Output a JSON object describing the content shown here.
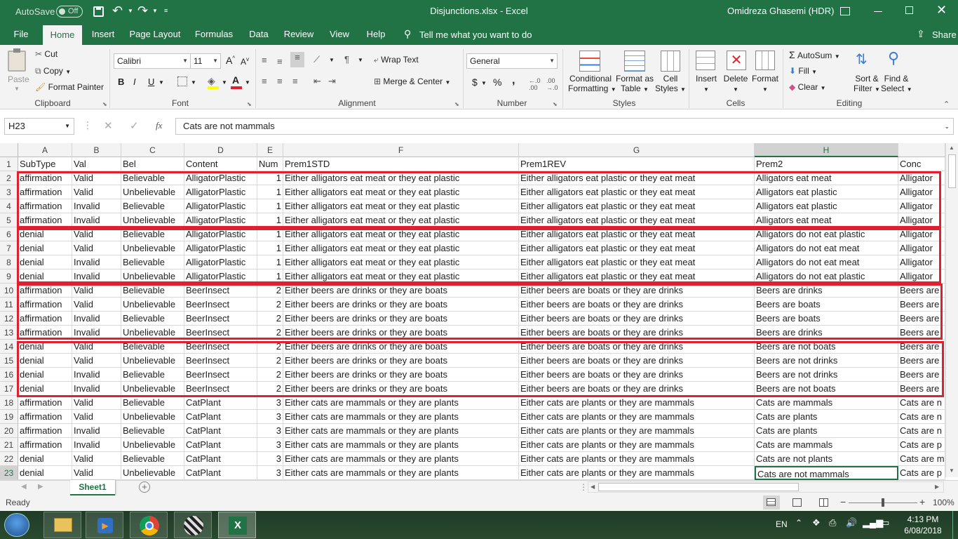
{
  "titlebar": {
    "autosave_label": "AutoSave",
    "autosave_state": "Off",
    "title": "Disjunctions.xlsx  -  Excel",
    "user": "Omidreza Ghasemi (HDR)"
  },
  "tabs": [
    "File",
    "Home",
    "Insert",
    "Page Layout",
    "Formulas",
    "Data",
    "Review",
    "View",
    "Help"
  ],
  "tell_me": "Tell me what you want to do",
  "share": "Share",
  "ribbon": {
    "clipboard": {
      "paste": "Paste",
      "cut": "Cut",
      "copy": "Copy",
      "format_painter": "Format Painter",
      "label": "Clipboard"
    },
    "font": {
      "name": "Calibri",
      "size": "11",
      "label": "Font",
      "bold": "B",
      "italic": "I",
      "underline": "U"
    },
    "alignment": {
      "wrap": "Wrap Text",
      "merge": "Merge & Center",
      "label": "Alignment"
    },
    "number": {
      "format": "General",
      "label": "Number",
      "currency": "$",
      "percent": "%",
      "comma": ","
    },
    "styles": {
      "cond1": "Conditional",
      "cond2": "Formatting",
      "fmt1": "Format as",
      "fmt2": "Table",
      "cell1": "Cell",
      "cell2": "Styles",
      "label": "Styles"
    },
    "cells": {
      "insert": "Insert",
      "delete": "Delete",
      "format": "Format",
      "label": "Cells"
    },
    "editing": {
      "autosum": "AutoSum",
      "fill": "Fill",
      "clear": "Clear",
      "sort1": "Sort &",
      "sort2": "Filter",
      "find1": "Find &",
      "find2": "Select",
      "label": "Editing"
    }
  },
  "formula": {
    "namebox": "H23",
    "fx": "fx",
    "content": "Cats are not mammals"
  },
  "columns": [
    {
      "letter": "A"
    },
    {
      "letter": "B"
    },
    {
      "letter": "C"
    },
    {
      "letter": "D"
    },
    {
      "letter": "E"
    },
    {
      "letter": "F"
    },
    {
      "letter": "G"
    },
    {
      "letter": "H"
    },
    {
      "letter": ""
    }
  ],
  "rows": [
    {
      "n": "1",
      "cells": [
        "SubType",
        "Val",
        "Bel",
        "Content",
        "Num",
        "Prem1STD",
        "Prem1REV",
        "Prem2",
        "Conc"
      ]
    },
    {
      "n": "2",
      "cells": [
        "affirmation",
        "Valid",
        "Believable",
        "AlligatorPlastic",
        "1",
        "Either alligators eat meat or they eat plastic",
        "Either alligators eat plastic or they eat meat",
        "Alligators eat meat",
        "Alligator"
      ]
    },
    {
      "n": "3",
      "cells": [
        "affirmation",
        "Valid",
        "Unbelievable",
        "AlligatorPlastic",
        "1",
        "Either alligators eat meat or they eat plastic",
        "Either alligators eat plastic or they eat meat",
        "Alligators eat plastic",
        "Alligator"
      ]
    },
    {
      "n": "4",
      "cells": [
        "affirmation",
        "Invalid",
        "Believable",
        "AlligatorPlastic",
        "1",
        "Either alligators eat meat or they eat plastic",
        "Either alligators eat plastic or they eat meat",
        "Alligators eat plastic",
        "Alligator"
      ]
    },
    {
      "n": "5",
      "cells": [
        "affirmation",
        "Invalid",
        "Unbelievable",
        "AlligatorPlastic",
        "1",
        "Either alligators eat meat or they eat plastic",
        "Either alligators eat plastic or they eat meat",
        "Alligators eat meat",
        "Alligator"
      ]
    },
    {
      "n": "6",
      "cells": [
        "denial",
        "Valid",
        "Believable",
        "AlligatorPlastic",
        "1",
        "Either alligators eat meat or they eat plastic",
        "Either alligators eat plastic or they eat meat",
        "Alligators do not eat plastic",
        "Alligator"
      ]
    },
    {
      "n": "7",
      "cells": [
        "denial",
        "Valid",
        "Unbelievable",
        "AlligatorPlastic",
        "1",
        "Either alligators eat meat or they eat plastic",
        "Either alligators eat plastic or they eat meat",
        "Alligators do not eat meat",
        "Alligator"
      ]
    },
    {
      "n": "8",
      "cells": [
        "denial",
        "Invalid",
        "Believable",
        "AlligatorPlastic",
        "1",
        "Either alligators eat meat or they eat plastic",
        "Either alligators eat plastic or they eat meat",
        "Alligators do not eat meat",
        "Alligator"
      ]
    },
    {
      "n": "9",
      "cells": [
        "denial",
        "Invalid",
        "Unbelievable",
        "AlligatorPlastic",
        "1",
        "Either alligators eat meat or they eat plastic",
        "Either alligators eat plastic or they eat meat",
        "Alligators do not eat plastic",
        "Alligator"
      ]
    },
    {
      "n": "10",
      "cells": [
        "affirmation",
        "Valid",
        "Believable",
        "BeerInsect",
        "2",
        "Either beers are drinks or they are boats",
        "Either beers are boats or they are drinks",
        "Beers are drinks",
        "Beers are"
      ]
    },
    {
      "n": "11",
      "cells": [
        "affirmation",
        "Valid",
        "Unbelievable",
        "BeerInsect",
        "2",
        "Either beers are drinks or they are boats",
        "Either beers are boats or they are drinks",
        "Beers are boats",
        "Beers are"
      ]
    },
    {
      "n": "12",
      "cells": [
        "affirmation",
        "Invalid",
        "Believable",
        "BeerInsect",
        "2",
        "Either beers are drinks or they are boats",
        "Either beers are boats or they are drinks",
        "Beers are boats",
        "Beers are"
      ]
    },
    {
      "n": "13",
      "cells": [
        "affirmation",
        "Invalid",
        "Unbelievable",
        "BeerInsect",
        "2",
        "Either beers are drinks or they are boats",
        "Either beers are boats or they are drinks",
        "Beers are drinks",
        "Beers are"
      ]
    },
    {
      "n": "14",
      "cells": [
        "denial",
        "Valid",
        "Believable",
        "BeerInsect",
        "2",
        "Either beers are drinks or they are boats",
        "Either beers are boats or they are drinks",
        "Beers are not boats",
        "Beers are"
      ]
    },
    {
      "n": "15",
      "cells": [
        "denial",
        "Valid",
        "Unbelievable",
        "BeerInsect",
        "2",
        "Either beers are drinks or they are boats",
        "Either beers are boats or they are drinks",
        "Beers are not drinks",
        "Beers are"
      ]
    },
    {
      "n": "16",
      "cells": [
        "denial",
        "Invalid",
        "Believable",
        "BeerInsect",
        "2",
        "Either beers are drinks or they are boats",
        "Either beers are boats or they are drinks",
        "Beers are not drinks",
        "Beers are"
      ]
    },
    {
      "n": "17",
      "cells": [
        "denial",
        "Invalid",
        "Unbelievable",
        "BeerInsect",
        "2",
        "Either beers are drinks or they are boats",
        "Either beers are boats or they are drinks",
        "Beers are not boats",
        "Beers are"
      ]
    },
    {
      "n": "18",
      "cells": [
        "affirmation",
        "Valid",
        "Believable",
        "CatPlant",
        "3",
        "Either cats are mammals or they are plants",
        "Either cats are plants or they are mammals",
        "Cats are mammals",
        "Cats are n"
      ]
    },
    {
      "n": "19",
      "cells": [
        "affirmation",
        "Valid",
        "Unbelievable",
        "CatPlant",
        "3",
        "Either cats are mammals or they are plants",
        "Either cats are plants or they are mammals",
        "Cats are plants",
        "Cats are n"
      ]
    },
    {
      "n": "20",
      "cells": [
        "affirmation",
        "Invalid",
        "Believable",
        "CatPlant",
        "3",
        "Either cats are mammals or they are plants",
        "Either cats are plants or they are mammals",
        "Cats are plants",
        "Cats are n"
      ]
    },
    {
      "n": "21",
      "cells": [
        "affirmation",
        "Invalid",
        "Unbelievable",
        "CatPlant",
        "3",
        "Either cats are mammals or they are plants",
        "Either cats are plants or they are mammals",
        "Cats are mammals",
        "Cats are p"
      ]
    },
    {
      "n": "22",
      "cells": [
        "denial",
        "Valid",
        "Believable",
        "CatPlant",
        "3",
        "Either cats are mammals or they are plants",
        "Either cats are plants or they are mammals",
        "Cats are not plants",
        "Cats are m"
      ]
    },
    {
      "n": "23",
      "cells": [
        "denial",
        "Valid",
        "Unbelievable",
        "CatPlant",
        "3",
        "Either cats are mammals or they are plants",
        "Either cats are plants or they are mammals",
        "Cats are not mammals",
        "Cats are p"
      ]
    }
  ],
  "sheet_tab": "Sheet1",
  "status": {
    "ready": "Ready",
    "zoom": "100%"
  },
  "taskbar": {
    "lang": "EN",
    "time": "4:13 PM",
    "date": "6/08/2018"
  },
  "colors": {
    "excel_green": "#217346",
    "highlight_red": "#e0202e"
  }
}
